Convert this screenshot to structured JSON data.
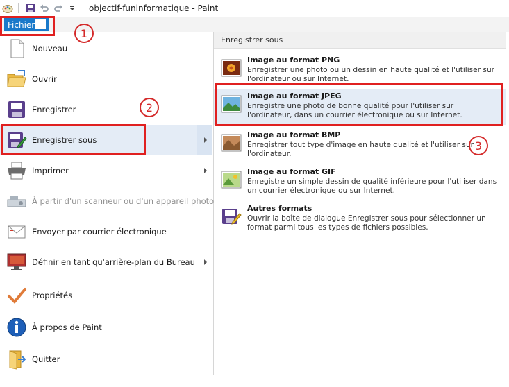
{
  "window": {
    "title": "objectif-funinformatique - Paint"
  },
  "ribbon": {
    "file_tab": "Fichier"
  },
  "file_menu": {
    "items": [
      {
        "label": "Nouveau",
        "icon": "new-document-icon",
        "enabled": true,
        "submenu": false
      },
      {
        "label": "Ouvrir",
        "icon": "open-folder-icon",
        "enabled": true,
        "submenu": false
      },
      {
        "label": "Enregistrer",
        "icon": "save-disk-icon",
        "enabled": true,
        "submenu": false
      },
      {
        "label": "Enregistrer sous",
        "icon": "save-as-icon",
        "enabled": true,
        "submenu": true,
        "selected": true
      },
      {
        "label": "Imprimer",
        "icon": "printer-icon",
        "enabled": true,
        "submenu": true
      },
      {
        "label": "À partir d'un scanneur ou d'un appareil photo",
        "icon": "scanner-icon",
        "enabled": false,
        "submenu": false
      },
      {
        "label": "Envoyer par courrier électronique",
        "icon": "email-icon",
        "enabled": true,
        "submenu": false
      },
      {
        "label": "Définir en tant qu'arrière-plan du Bureau",
        "icon": "desktop-background-icon",
        "enabled": true,
        "submenu": true
      },
      {
        "label": "Propriétés",
        "icon": "checkmark-icon",
        "enabled": true,
        "submenu": false
      },
      {
        "label": "À propos de Paint",
        "icon": "info-icon",
        "enabled": true,
        "submenu": false
      },
      {
        "label": "Quitter",
        "icon": "exit-icon",
        "enabled": true,
        "submenu": false
      }
    ]
  },
  "save_as_menu": {
    "header": "Enregistrer sous",
    "items": [
      {
        "title": "Image au format PNG",
        "desc": "Enregistrer une photo ou un dessin en haute qualité et l'utiliser sur l'ordinateur ou sur Internet.",
        "icon": "png-image-icon"
      },
      {
        "title": "Image au format JPEG",
        "desc": "Enregistre une photo de bonne qualité pour l'utiliser sur l'ordinateur, dans un courrier électronique ou sur Internet.",
        "icon": "jpeg-image-icon",
        "selected": true
      },
      {
        "title": "Image au format BMP",
        "desc": "Enregistrer tout type d'image en haute qualité et l'utiliser sur l'ordinateur.",
        "icon": "bmp-image-icon"
      },
      {
        "title": "Image au format GIF",
        "desc": "Enregistre un simple dessin de qualité inférieure pour l'utiliser dans un courrier électronique ou sur Internet.",
        "icon": "gif-image-icon"
      },
      {
        "title": "Autres formats",
        "desc": "Ouvrir la boîte de dialogue Enregistrer sous pour sélectionner un format parmi tous les types de fichiers possibles.",
        "icon": "other-formats-icon"
      }
    ]
  },
  "annotations": {
    "step1": "1",
    "step2": "2",
    "step3": "3",
    "color": "#e02020"
  }
}
